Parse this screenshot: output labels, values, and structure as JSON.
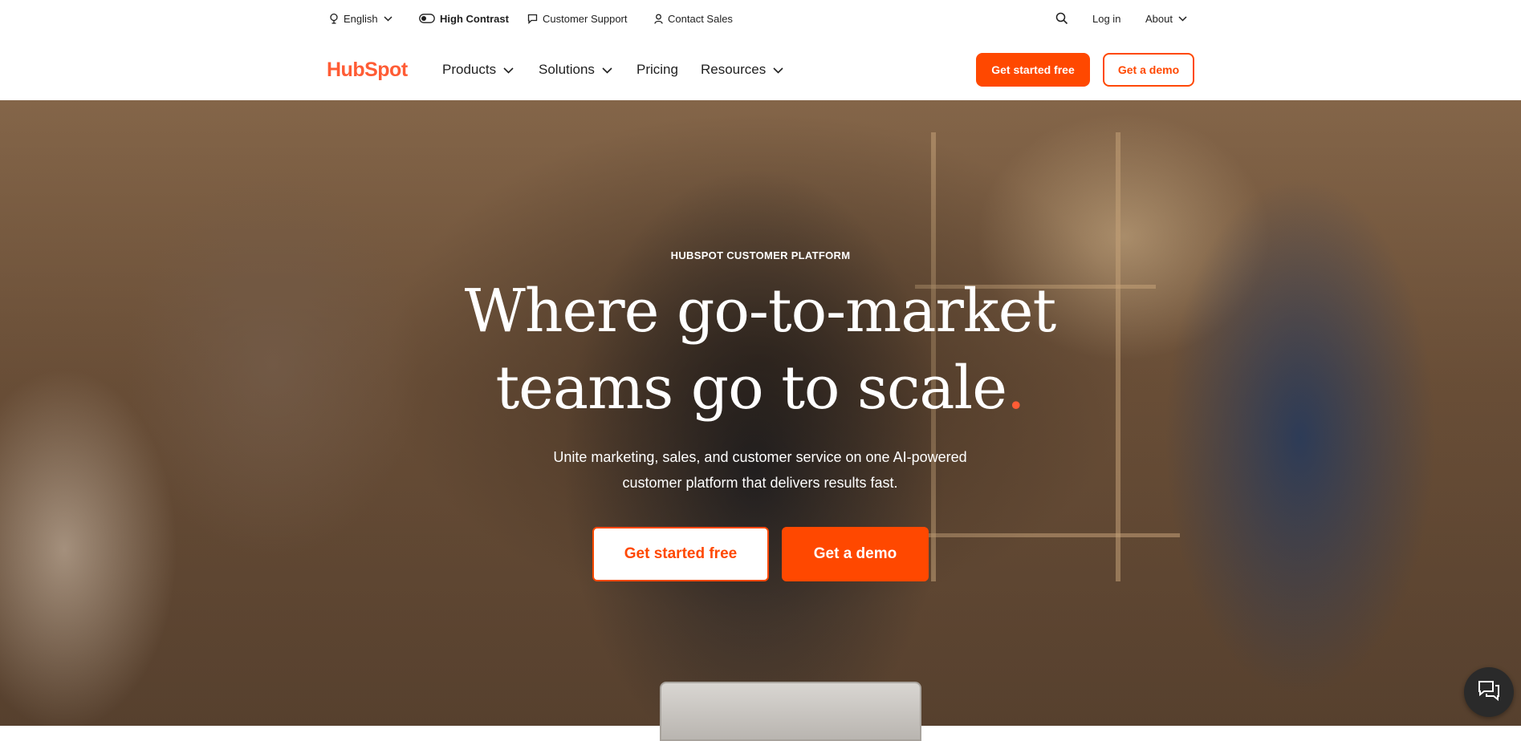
{
  "utility_bar": {
    "language": "English",
    "high_contrast": "High Contrast",
    "customer_support": "Customer Support",
    "contact_sales": "Contact Sales",
    "login": "Log in",
    "about": "About"
  },
  "nav": {
    "logo": "HubSpot",
    "items": [
      "Products",
      "Solutions",
      "Pricing",
      "Resources"
    ],
    "get_started": "Get started free",
    "get_demo": "Get a demo"
  },
  "hero": {
    "eyebrow": "HUBSPOT CUSTOMER PLATFORM",
    "headline_line1": "Where go-to-market",
    "headline_line2": "teams go to scale",
    "headline_dot": ".",
    "subhead_line1": "Unite marketing, sales, and customer service on one AI-powered",
    "subhead_line2": "customer platform that delivers results fast.",
    "cta_primary": "Get started free",
    "cta_secondary": "Get a demo"
  },
  "colors": {
    "brand_orange": "#ff4800",
    "logo_orange": "#ff5c35",
    "text_dark": "#1f1f1f"
  },
  "icons": [
    "globe-icon",
    "toggle-icon",
    "chat-bubble-icon",
    "person-icon",
    "search-icon",
    "chevron-down-icon",
    "chat-widget-icon"
  ]
}
